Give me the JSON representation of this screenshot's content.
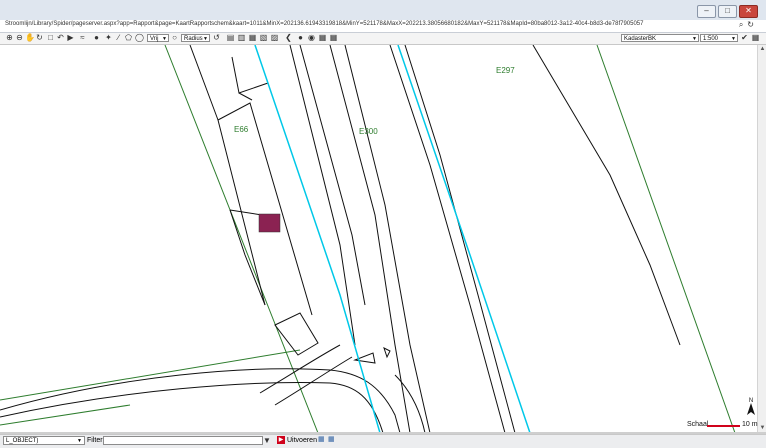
{
  "window": {
    "buttons": [
      {
        "name": "minimize",
        "glyph": "–"
      },
      {
        "name": "maximize",
        "glyph": "□"
      },
      {
        "name": "close",
        "glyph": "✕"
      }
    ]
  },
  "address": {
    "url": "Stroomlijn/Library/Spider/pageserver.aspx?app=Rapport&page=KaartRapportschem&kaart=1011&MinX=202136.61943319818&MinY=521178&MaxX=202213.38056680182&MaxY=521178&MapId=80ba8012-3a12-40c4-b8d3-de78f7905057",
    "search_glyph": "⌕",
    "refresh_glyph": "↻"
  },
  "toolbar": {
    "select_mode": "Vrij",
    "radius_mode": "Radius",
    "layer": "KadasterBK",
    "scale": "1:500"
  },
  "map": {
    "labels": [
      "E66",
      "E300",
      "E297"
    ]
  },
  "scale": {
    "label": "Schaal",
    "unit": "10 m"
  },
  "status": {
    "object_select": "L_OBJECT)",
    "filter_label": "Filter",
    "filter_value": "",
    "run_label": "Uitvoeren"
  },
  "colors": {
    "parcel": "#2e7d2e",
    "road_line": "#111111",
    "cyan_line": "#00c8e8",
    "marker": "#8b2252",
    "scale_bar": "#d0021b"
  }
}
